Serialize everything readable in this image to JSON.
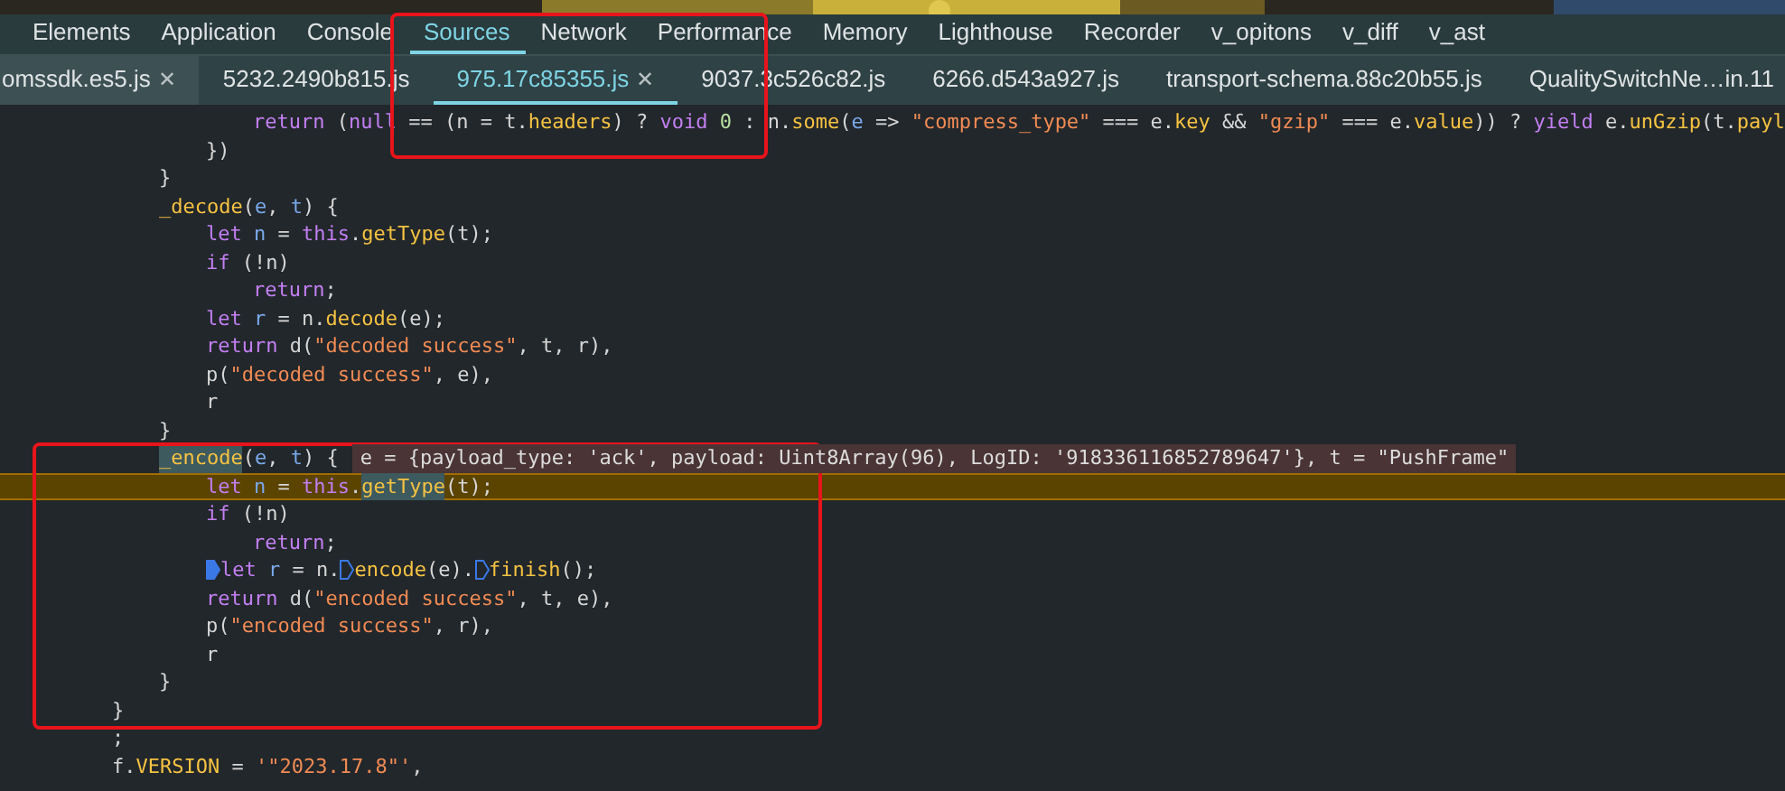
{
  "panel_tabs": [
    {
      "label": "Elements",
      "selected": false
    },
    {
      "label": "Application",
      "selected": false
    },
    {
      "label": "Console",
      "selected": false
    },
    {
      "label": "Sources",
      "selected": true
    },
    {
      "label": "Network",
      "selected": false
    },
    {
      "label": "Performance",
      "selected": false
    },
    {
      "label": "Memory",
      "selected": false
    },
    {
      "label": "Lighthouse",
      "selected": false
    },
    {
      "label": "Recorder",
      "selected": false
    },
    {
      "label": "v_opitons",
      "selected": false
    },
    {
      "label": "v_diff",
      "selected": false
    },
    {
      "label": "v_ast",
      "selected": false
    }
  ],
  "file_tabs": [
    {
      "label": "omssdk.es5.js",
      "selected": false,
      "close": "✕"
    },
    {
      "label": "5232.2490b815.js",
      "selected": false
    },
    {
      "label": "975.17c85355.js",
      "selected": true,
      "close": "✕"
    },
    {
      "label": "9037.3c526c82.js",
      "selected": false
    },
    {
      "label": "6266.d543a927.js",
      "selected": false
    },
    {
      "label": "transport-schema.88c20b55.js",
      "selected": false
    },
    {
      "label": "QualitySwitchNe…in.11",
      "selected": false
    }
  ],
  "code_lines": [
    {
      "children": [
        {
          "children": [
            {
              "children": [
                {
                  "paused": false,
                  "tokens": [
                    {
                      "kind": "kw",
                      "text": "return"
                    },
                    {
                      "kind": "plain",
                      "text": " ("
                    },
                    {
                      "kind": "kw",
                      "text": "null"
                    },
                    {
                      "kind": "plain",
                      "text": " == (n = t."
                    },
                    {
                      "kind": "prop",
                      "text": "headers"
                    },
                    {
                      "kind": "plain",
                      "text": ") ? "
                    },
                    {
                      "kind": "kw",
                      "text": "void"
                    },
                    {
                      "kind": "num",
                      "text": " 0"
                    },
                    {
                      "kind": "plain",
                      "text": " : n."
                    },
                    {
                      "kind": "prop",
                      "text": "some"
                    },
                    {
                      "kind": "plain",
                      "text": "("
                    },
                    {
                      "kind": "var",
                      "text": "e"
                    },
                    {
                      "kind": "plain",
                      "text": " => "
                    },
                    {
                      "kind": "str",
                      "text": "\"compress_type\""
                    },
                    {
                      "kind": "plain",
                      "text": " === e."
                    },
                    {
                      "kind": "prop",
                      "text": "key"
                    },
                    {
                      "kind": "plain",
                      "text": " && "
                    },
                    {
                      "kind": "str",
                      "text": "\"gzip\""
                    },
                    {
                      "kind": "plain",
                      "text": " === e."
                    },
                    {
                      "kind": "prop",
                      "text": "value"
                    },
                    {
                      "kind": "plain",
                      "text": ")) ? "
                    },
                    {
                      "kind": "kw",
                      "text": "yield"
                    },
                    {
                      "kind": "plain",
                      "text": " e."
                    },
                    {
                      "kind": "prop",
                      "text": "unGzip"
                    },
                    {
                      "kind": "plain",
                      "text": "(t."
                    },
                    {
                      "kind": "prop",
                      "text": "payl"
                    }
                  ]
                }
              ]
            },
            {
              "paused": false,
              "tokens": [
                {
                  "kind": "plain",
                  "text": "})"
                }
              ]
            }
          ]
        },
        {
          "paused": false,
          "tokens": [
            {
              "kind": "plain",
              "text": "}"
            }
          ]
        },
        {
          "paused": false,
          "tokens": [
            {
              "kind": "prop",
              "text": "_decode",
              "highlight": false
            },
            {
              "kind": "plain",
              "text": "("
            },
            {
              "kind": "var",
              "text": "e"
            },
            {
              "kind": "plain",
              "text": ", "
            },
            {
              "kind": "var",
              "text": "t"
            },
            {
              "kind": "plain",
              "text": ") {"
            }
          ],
          "children": [
            {
              "paused": false,
              "tokens": [
                {
                  "kind": "kw",
                  "text": "let"
                },
                {
                  "kind": "var",
                  "text": " n"
                },
                {
                  "kind": "plain",
                  "text": " = "
                },
                {
                  "kind": "kw",
                  "text": "this"
                },
                {
                  "kind": "plain",
                  "text": "."
                },
                {
                  "kind": "prop",
                  "text": "getType",
                  "highlight": false
                },
                {
                  "kind": "plain",
                  "text": "(t);"
                }
              ]
            },
            {
              "paused": false,
              "tokens": [
                {
                  "kind": "kw",
                  "text": "if"
                },
                {
                  "kind": "plain",
                  "text": " (!n)"
                }
              ],
              "children": [
                {
                  "paused": false,
                  "tokens": [
                    {
                      "kind": "kw",
                      "text": "return"
                    },
                    {
                      "kind": "plain",
                      "text": ";"
                    }
                  ]
                }
              ]
            },
            {
              "paused": false,
              "tokens": [
                {
                  "kind": "kw",
                  "text": "let"
                },
                {
                  "kind": "var",
                  "text": " r"
                },
                {
                  "kind": "plain",
                  "text": " = n."
                },
                {
                  "kind": "prop",
                  "text": "decode"
                },
                {
                  "kind": "plain",
                  "text": "(e);"
                }
              ]
            },
            {
              "paused": false,
              "tokens": [
                {
                  "kind": "kw",
                  "text": "return"
                },
                {
                  "kind": "plain",
                  "text": " d("
                },
                {
                  "kind": "str",
                  "text": "\"decoded success\""
                },
                {
                  "kind": "plain",
                  "text": ", t, r),"
                }
              ]
            },
            {
              "paused": false,
              "tokens": [
                {
                  "kind": "plain",
                  "text": "p("
                },
                {
                  "kind": "str",
                  "text": "\"decoded success\""
                },
                {
                  "kind": "plain",
                  "text": ", e),"
                }
              ]
            },
            {
              "paused": false,
              "tokens": [
                {
                  "kind": "plain",
                  "text": "r"
                }
              ]
            }
          ]
        },
        {
          "paused": false,
          "tokens": [
            {
              "kind": "plain",
              "text": "}"
            }
          ]
        },
        {
          "paused": false,
          "inline_value": "e = {payload_type: 'ack', payload: Uint8Array(96), LogID: '918336116852789647'}, t = \"PushFrame\"",
          "tokens": [
            {
              "kind": "prop",
              "text": "_encode",
              "highlight": true
            },
            {
              "kind": "plain",
              "text": "("
            },
            {
              "kind": "var",
              "text": "e"
            },
            {
              "kind": "plain",
              "text": ", "
            },
            {
              "kind": "var",
              "text": "t"
            },
            {
              "kind": "plain",
              "text": ") {"
            }
          ],
          "children": [
            {
              "paused": true,
              "tokens": [
                {
                  "kind": "kw",
                  "text": "let"
                },
                {
                  "kind": "var",
                  "text": " n"
                },
                {
                  "kind": "plain",
                  "text": " = "
                },
                {
                  "kind": "kw",
                  "text": "this"
                },
                {
                  "kind": "plain",
                  "text": "."
                },
                {
                  "kind": "prop",
                  "text": "getType",
                  "highlight": true
                },
                {
                  "kind": "plain",
                  "text": "(t);"
                }
              ]
            },
            {
              "paused": false,
              "tokens": [
                {
                  "kind": "kw",
                  "text": "if"
                },
                {
                  "kind": "plain",
                  "text": " (!n)"
                }
              ],
              "children": [
                {
                  "paused": false,
                  "tokens": [
                    {
                      "kind": "kw",
                      "text": "return"
                    },
                    {
                      "kind": "plain",
                      "text": ";"
                    }
                  ]
                }
              ]
            },
            {
              "paused": false,
              "tokens": [
                {
                  "kind": "breakpoint",
                  "active": true
                },
                {
                  "kind": "kw",
                  "text": "let"
                },
                {
                  "kind": "var",
                  "text": " r"
                },
                {
                  "kind": "plain",
                  "text": " = n."
                },
                {
                  "kind": "breakpoint",
                  "active": false
                },
                {
                  "kind": "prop",
                  "text": "encode"
                },
                {
                  "kind": "plain",
                  "text": "(e)."
                },
                {
                  "kind": "breakpoint",
                  "active": false
                },
                {
                  "kind": "prop",
                  "text": "finish"
                },
                {
                  "kind": "plain",
                  "text": "();"
                }
              ]
            },
            {
              "paused": false,
              "tokens": [
                {
                  "kind": "kw",
                  "text": "return"
                },
                {
                  "kind": "plain",
                  "text": " d("
                },
                {
                  "kind": "str",
                  "text": "\"encoded success\""
                },
                {
                  "kind": "plain",
                  "text": ", t, e),"
                }
              ]
            },
            {
              "paused": false,
              "tokens": [
                {
                  "kind": "plain",
                  "text": "p("
                },
                {
                  "kind": "str",
                  "text": "\"encoded success\""
                },
                {
                  "kind": "plain",
                  "text": ", r),"
                }
              ]
            },
            {
              "paused": false,
              "tokens": [
                {
                  "kind": "plain",
                  "text": "r"
                }
              ]
            }
          ]
        },
        {
          "paused": false,
          "tokens": [
            {
              "kind": "plain",
              "text": "}"
            }
          ]
        }
      ]
    },
    {
      "paused": false,
      "tokens": [
        {
          "kind": "plain",
          "text": "}"
        }
      ]
    },
    {
      "paused": false,
      "tokens": [
        {
          "kind": "plain",
          "text": ";"
        }
      ]
    },
    {
      "paused": false,
      "tokens": [
        {
          "kind": "plain",
          "text": "f."
        },
        {
          "kind": "prop",
          "text": "VERSION"
        },
        {
          "kind": "plain",
          "text": " = "
        },
        {
          "kind": "str",
          "text": "'\"2023.17.8\"'"
        },
        {
          "kind": "plain",
          "text": ","
        }
      ]
    }
  ]
}
